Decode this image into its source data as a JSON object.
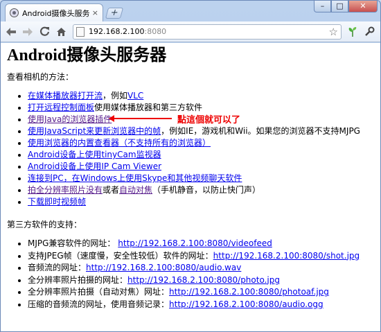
{
  "browser": {
    "tab_title": "Android摄像头服务器",
    "tab_close": "×",
    "new_tab": "+",
    "window_controls": {
      "minimize": "–",
      "maximize": "□",
      "close": "✕"
    },
    "url_host": "192.168.2.100",
    "url_port": ":8080"
  },
  "page": {
    "title": "Android摄像头服务器",
    "methods_heading": "查看相机的方法：",
    "methods": [
      {
        "link": "在媒体播放器打开流",
        "text": "，例如",
        "link2": "VLC"
      },
      {
        "link": "打开远程控制面板",
        "text": "使用媒体播放器和第三方软件"
      },
      {
        "link": "使用Java的浏览器插件",
        "text": ""
      },
      {
        "link": "使用JavaScript来更新浏览器中的帧",
        "text": "，例如IE，游戏机和Wii。如果您的浏览器不支持MJPG"
      },
      {
        "link": "使用浏览器的内置查看器（不支持所有的浏览器）",
        "text": ""
      },
      {
        "link": "Android设备上使用tinyCam监视器",
        "text": ""
      },
      {
        "link": "Android设备上使用IP Cam Viewer",
        "text": ""
      },
      {
        "link": "连接到PC，在Windows上使用Skype和其他视频聊天软件",
        "text": ""
      },
      {
        "link": "拍全分辨率照片没有",
        "text": "或者",
        "link2": "自动对焦",
        "text2": "（手机静音，以防止快门声）"
      },
      {
        "link": "下载即时视频帧",
        "text": ""
      }
    ],
    "annotation": "點這個就可以了",
    "thirdparty_heading": "第三方软件的支持：",
    "thirdparty": [
      {
        "text": "MJPG兼容软件的网址：",
        "url": "http://192.168.2.100:8080/videofeed"
      },
      {
        "text": "支持JPEG帧（速度慢，安全性较低）软件的网址：",
        "url": "http://192.168.2.100:8080/shot.jpg"
      },
      {
        "text": "音频流的网址：",
        "url": "http://192.168.2.100:8080/audio.wav"
      },
      {
        "text": "全分辨率照片拍摄的网址：",
        "url": "http://192.168.2.100:8080/photo.jpg"
      },
      {
        "text": "全分辨率照片拍摄（自动对焦）网址：",
        "url": "http://192.168.2.100:8080/photoaf.jpg"
      },
      {
        "text": "压缩的音频流的网址，使用音频记录：",
        "url": "http://192.168.2.100:8080/audio.ogg"
      }
    ]
  },
  "icons": [
    "page-favicon",
    "back-arrow-icon",
    "forward-arrow-icon",
    "reload-icon",
    "home-icon",
    "page-icon",
    "bookmark-star-icon",
    "leaf-extension-icon",
    "wrench-icon"
  ],
  "colors": {
    "link": "#0000ee",
    "visited_link": "#551a8b",
    "annotation": "#e00000"
  }
}
